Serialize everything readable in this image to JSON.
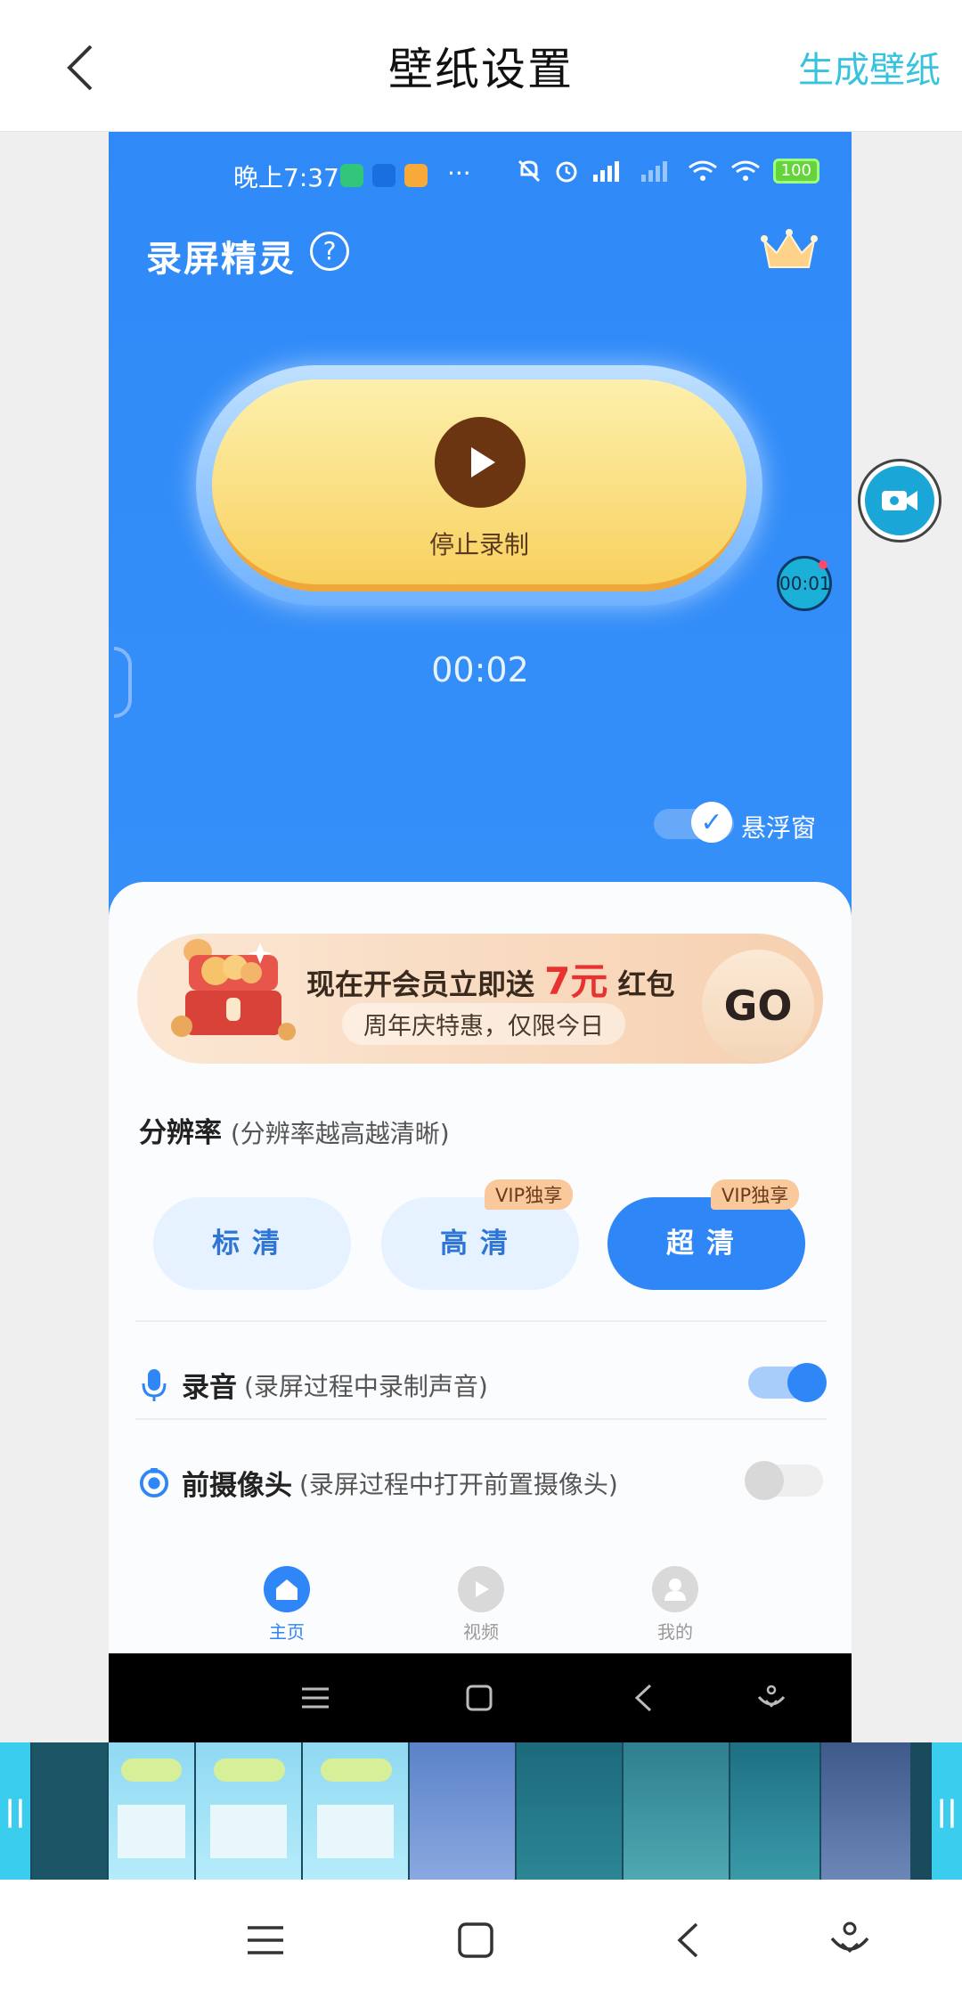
{
  "header": {
    "title": "壁纸设置",
    "action": "生成壁纸"
  },
  "preview": {
    "status": {
      "time": "晚上7:37",
      "dots": "···",
      "battery": "100"
    },
    "app_name": "录屏精灵",
    "record": {
      "label": "停止录制",
      "timer": "00:02",
      "mini_timer": "00:01"
    },
    "floating": {
      "label": "悬浮窗",
      "enabled": true
    },
    "promo": {
      "main_prefix": "现在开会员立即送",
      "amount": "7元",
      "main_suffix": "红包",
      "sub": "周年庆特惠，仅限今日",
      "go": "GO"
    },
    "resolution": {
      "title": "分辨率",
      "hint": "(分辨率越高越清晰)",
      "options": [
        {
          "label": "标清",
          "badge": "",
          "selected": false
        },
        {
          "label": "高清",
          "badge": "VIP独享",
          "selected": false
        },
        {
          "label": "超清",
          "badge": "VIP独享",
          "selected": true
        }
      ]
    },
    "audio": {
      "title": "录音",
      "hint": "(录屏过程中录制声音)",
      "enabled": true
    },
    "camera": {
      "title": "前摄像头",
      "hint": "(录屏过程中打开前置摄像头)",
      "enabled": false
    },
    "tabs": [
      {
        "label": "主页",
        "icon": "home-icon",
        "active": true
      },
      {
        "label": "视频",
        "icon": "video-icon",
        "active": false
      },
      {
        "label": "我的",
        "icon": "profile-icon",
        "active": false
      }
    ]
  },
  "thumbnails": [
    "screenshot-1",
    "screenshot-2",
    "screenshot-3",
    "home-screen-1",
    "home-screen-2",
    "home-screen-3",
    "home-screen-4",
    "home-screen-5"
  ],
  "colors": {
    "accent": "#35c4dc",
    "app_blue": "#2f8af8",
    "record_gold": "#f8d160"
  }
}
